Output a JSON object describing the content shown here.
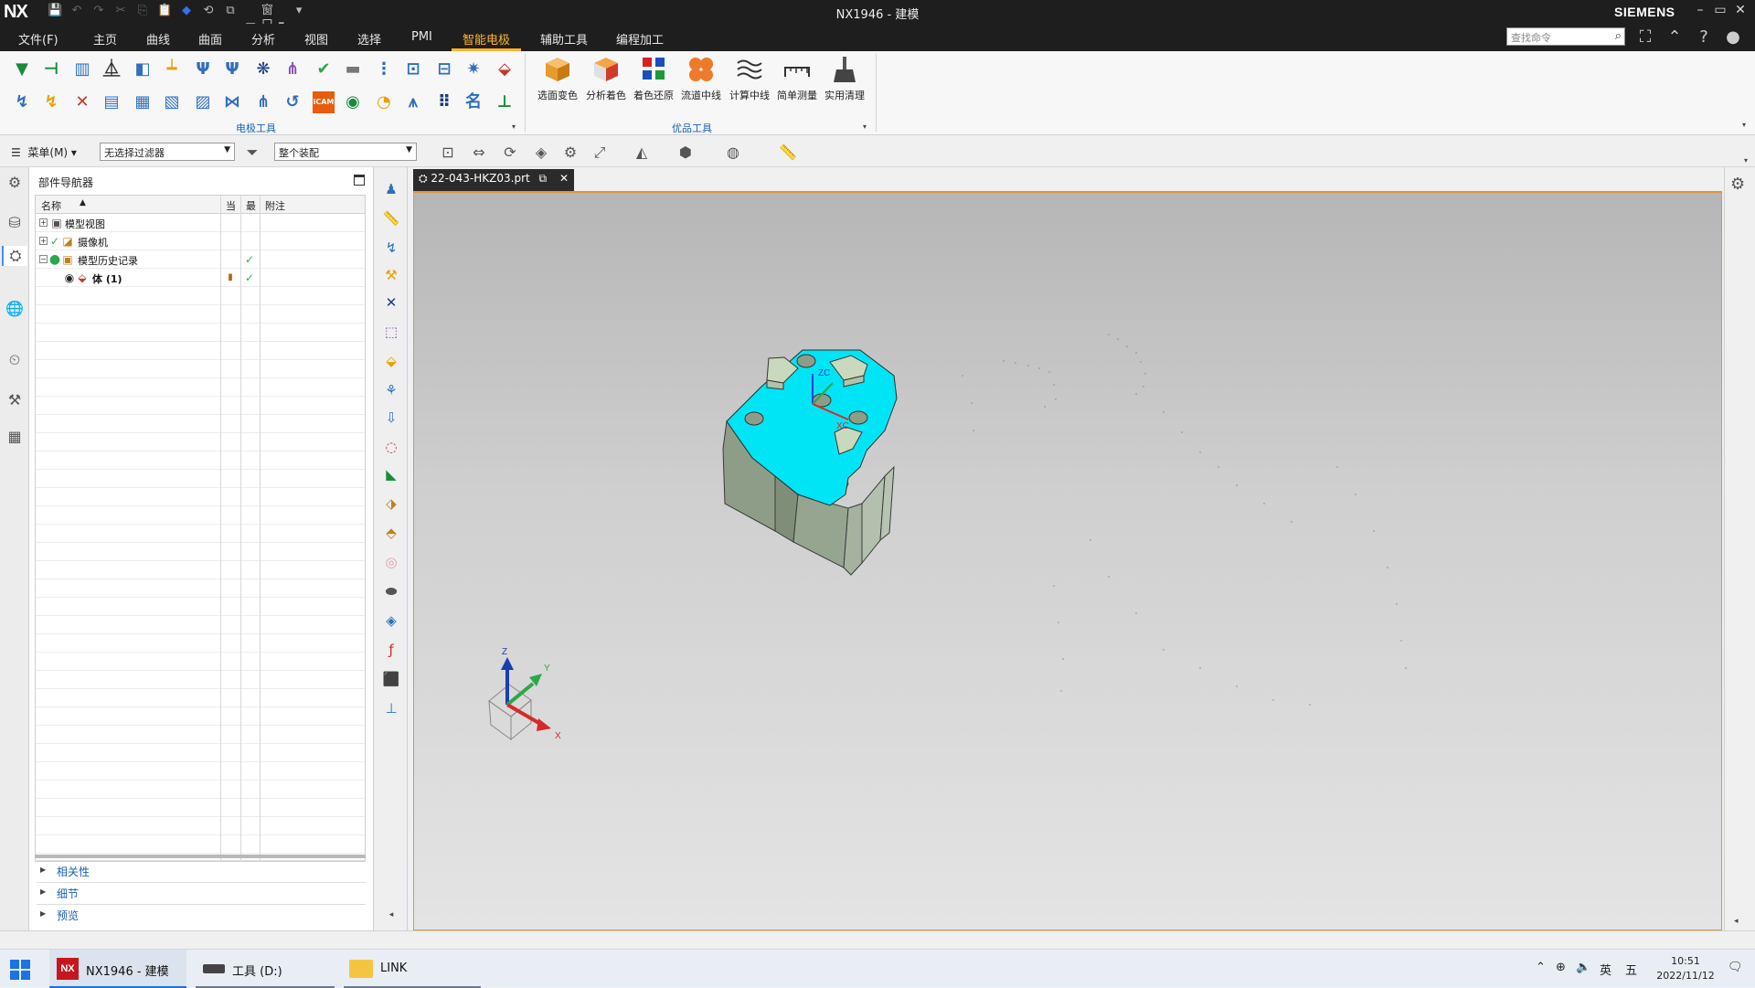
{
  "window": {
    "logo": "NX",
    "title": "NX1946 - 建模",
    "brand": "SIEMENS",
    "window_menu": "窗口",
    "controls": [
      "–",
      "▭",
      "✕"
    ]
  },
  "menubar": {
    "tabs": [
      "文件(F)",
      "主页",
      "曲线",
      "曲面",
      "分析",
      "视图",
      "选择",
      "PMI",
      "智能电极",
      "辅助工具",
      "编程加工"
    ],
    "active_tab": "智能电极",
    "search_placeholder": "查找命令"
  },
  "ribbon": {
    "groups": [
      {
        "label": "电极工具"
      },
      {
        "label": "优品工具"
      }
    ],
    "big_buttons": [
      "选面变色",
      "分析着色",
      "着色还原",
      "流道中线",
      "计算中线",
      "简单测量",
      "实用清理"
    ],
    "accent_color": "#1a5fb4"
  },
  "selection_bar": {
    "menu_label": "菜单(M)",
    "type_filter": "无选择过滤器",
    "scope": "整个装配"
  },
  "navigator": {
    "title": "部件导航器",
    "columns": [
      "名称",
      "当",
      "最",
      "附注"
    ],
    "rows": [
      {
        "label": "模型视图",
        "expander": "+",
        "current_flag": "",
        "latest_flag": ""
      },
      {
        "label": "摄像机",
        "expander": "+",
        "current_flag": "",
        "latest_flag": ""
      },
      {
        "label": "模型历史记录",
        "expander": "−",
        "current_flag": "",
        "latest_flag": "✓"
      },
      {
        "label": "体 (1)",
        "expander": "",
        "current_flag": "▮",
        "latest_flag": "✓"
      }
    ],
    "sections": [
      "相关性",
      "细节",
      "预览"
    ]
  },
  "graphics": {
    "tab_title": "22-043-HKZ03.prt",
    "tab_close": "✕",
    "model_top_color": "#00e5f5",
    "model_side_color": "#8c9c85",
    "border_color": "#e3943a",
    "triad_labels": {
      "x": "X",
      "y": "Y",
      "z": "Z"
    },
    "wcs_labels": {
      "z": "ZC",
      "x": "XC"
    }
  },
  "taskbar": {
    "items": [
      {
        "label": "NX1946 - 建模",
        "icon": "nx-icon",
        "active": true
      },
      {
        "label": "工具 (D:)",
        "icon": "drive-icon",
        "active": false
      },
      {
        "label": "LINK",
        "icon": "folder-icon",
        "active": false
      }
    ],
    "ime": "英",
    "ime_mode": "五",
    "time": "10:51",
    "date": "2022/11/12"
  }
}
